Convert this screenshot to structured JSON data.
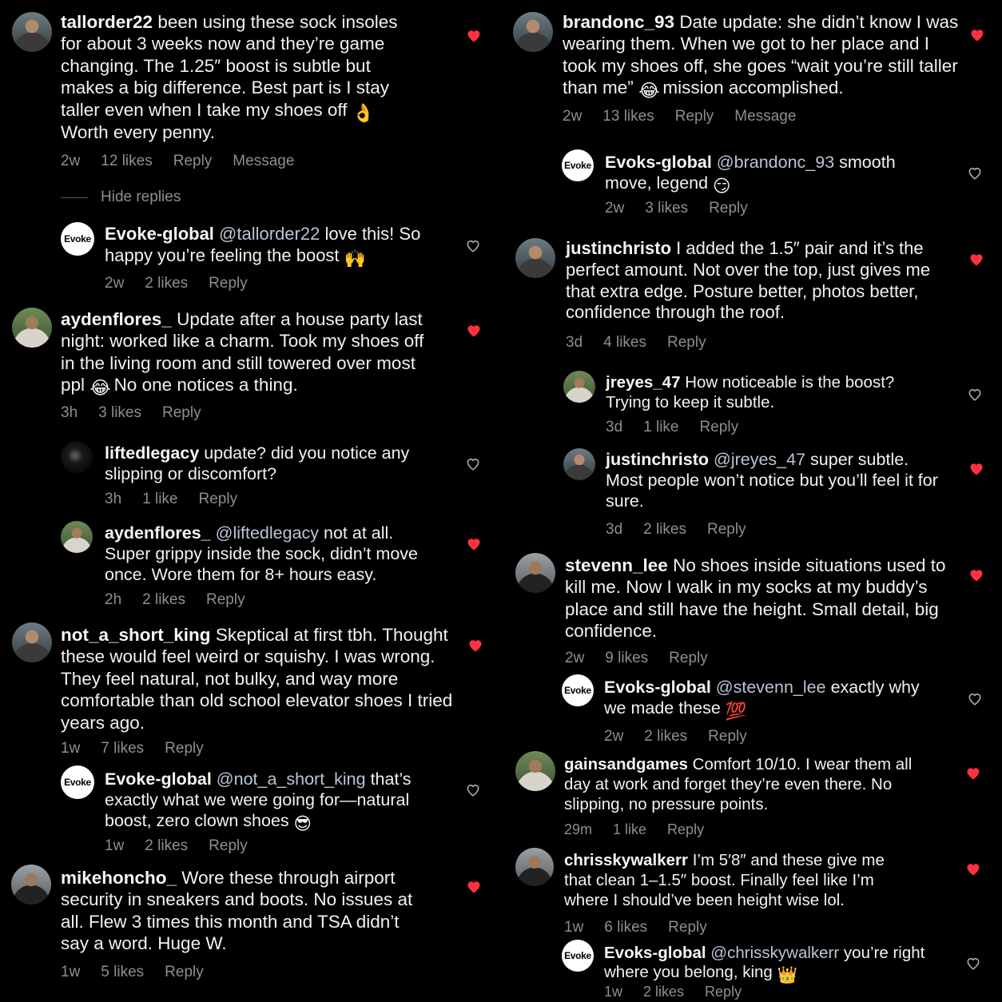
{
  "left": [
    {
      "user": "tallorder22",
      "text": "been using these sock insoles for about 3 weeks now and they’re game changing. The 1.25″ boost is subtle but makes a big difference. Best part is I stay taller even when I take my shoes off",
      "emoji": "👌",
      "text2": "Worth every penny.",
      "time": "2w",
      "likes": "12 likes",
      "reply": "Reply",
      "message": "Message",
      "liked": true
    },
    {
      "hide": "Hide replies"
    },
    {
      "user": "Evoke-global",
      "mention": "@tallorder22",
      "text": "love this! So happy you’re feeling the boost",
      "emoji": "🙌",
      "time": "2w",
      "likes": "2 likes",
      "reply": "Reply",
      "liked": false,
      "avatar": "Evoke"
    },
    {
      "user": "aydenflores_",
      "text": "Update after a house party last night: worked like a charm. Took my shoes off in the living room and still towered over most ppl",
      "emoji": "😂",
      "text2": "No one notices a thing.",
      "time": "3h",
      "likes": "3 likes",
      "reply": "Reply",
      "liked": true
    },
    {
      "user": "liftedlegacy",
      "text": "update? did you notice any slipping or discomfort?",
      "time": "3h",
      "likes": "1 like",
      "reply": "Reply",
      "liked": false
    },
    {
      "user": "aydenflores_",
      "mention": "@liftedlegacy",
      "text": "not at all. Super grippy inside the sock, didn’t move once. Wore them for 8+ hours easy.",
      "time": "2h",
      "likes": "2 likes",
      "reply": "Reply",
      "liked": true
    },
    {
      "user": "not_a_short_king",
      "text": "Skeptical at first tbh. Thought these would feel weird or squishy. I was wrong. They feel natural, not bulky, and way more comfortable than old school elevator shoes I tried years ago.",
      "time": "1w",
      "likes": "7 likes",
      "reply": "Reply",
      "liked": true
    },
    {
      "user": "Evoke-global",
      "mention": "@not_a_short_king",
      "text": "that’s exactly what we were going for—natural boost, zero clown shoes",
      "emoji": "😎",
      "time": "1w",
      "likes": "2 likes",
      "reply": "Reply",
      "liked": false,
      "avatar": "Evoke"
    },
    {
      "user": "mikehoncho_",
      "text": "Wore these through airport security in sneakers and boots. No issues at all. Flew 3 times this month and TSA didn’t say a word. Huge W.",
      "time": "1w",
      "likes": "5 likes",
      "reply": "Reply",
      "liked": true
    }
  ],
  "right": [
    {
      "user": "brandonc_93",
      "text": "Date update: she didn’t know I was wearing them. When we got to her place and I took my shoes off, she goes “wait you’re still taller than me”",
      "emoji": "😂",
      "text2": "mission accomplished.",
      "time": "2w",
      "likes": "13 likes",
      "reply": "Reply",
      "message": "Message",
      "liked": true
    },
    {
      "user": "Evoks-global",
      "mention": "@brandonc_93",
      "text": "smooth move, legend",
      "emoji": "😏",
      "time": "2w",
      "likes": "3 likes",
      "reply": "Reply",
      "liked": false,
      "avatar": "Evoke"
    },
    {
      "user": "justinchristo",
      "text": "I added the 1.5″ pair and it’s the perfect amount. Not over the top, just gives me that extra edge. Posture better, photos better, confidence through the roof.",
      "time": "3d",
      "likes": "4 likes",
      "reply": "Reply",
      "liked": true
    },
    {
      "user": "jreyes_47",
      "text": "How noticeable is the boost? Trying to keep it subtle.",
      "time": "3d",
      "likes": "1 like",
      "reply": "Reply",
      "liked": false
    },
    {
      "user": "justinchristo",
      "mention": "@jreyes_47",
      "text": "super subtle. Most people won’t notice but you’ll feel it for sure.",
      "time": "3d",
      "likes": "2 likes",
      "reply": "Reply",
      "liked": true
    },
    {
      "user": "stevenn_lee",
      "text": "No shoes inside situations used to kill me. Now I walk in my socks at my buddy’s place and still have the height. Small detail, big confidence.",
      "time": "2w",
      "likes": "9 likes",
      "reply": "Reply",
      "liked": true
    },
    {
      "user": "Evoks-global",
      "mention": "@stevenn_lee",
      "text": "exactly why we made these",
      "emoji": "💯",
      "time": "2w",
      "likes": "2 likes",
      "reply": "Reply",
      "liked": false,
      "avatar": "Evoke"
    },
    {
      "user": "gainsandgames",
      "text": "Comfort 10/10. I wear them all day at work and forget they’re even there. No slipping, no pressure points.",
      "time": "29m",
      "likes": "1 like",
      "reply": "Reply",
      "liked": true
    },
    {
      "user": "chrisskywalkerr",
      "text": "I’m 5′8″ and these give me that clean 1–1.5″ boost. Finally feel like I’m where I should’ve been height wise lol.",
      "time": "1w",
      "likes": "6 likes",
      "reply": "Reply",
      "liked": true
    },
    {
      "user": "Evoks-global",
      "mention": "@chrisskywalkerr",
      "text": "you’re right where you belong, king",
      "emoji": "👑",
      "time": "1w",
      "likes": "2 likes",
      "reply": "Reply",
      "liked": false,
      "avatar": "Evoke"
    }
  ],
  "colors": {
    "heart_liked": "#ff3040",
    "heart_outline": "#a8a8a8",
    "muted": "#8e8e8e",
    "mention": "#b9c4d6"
  }
}
